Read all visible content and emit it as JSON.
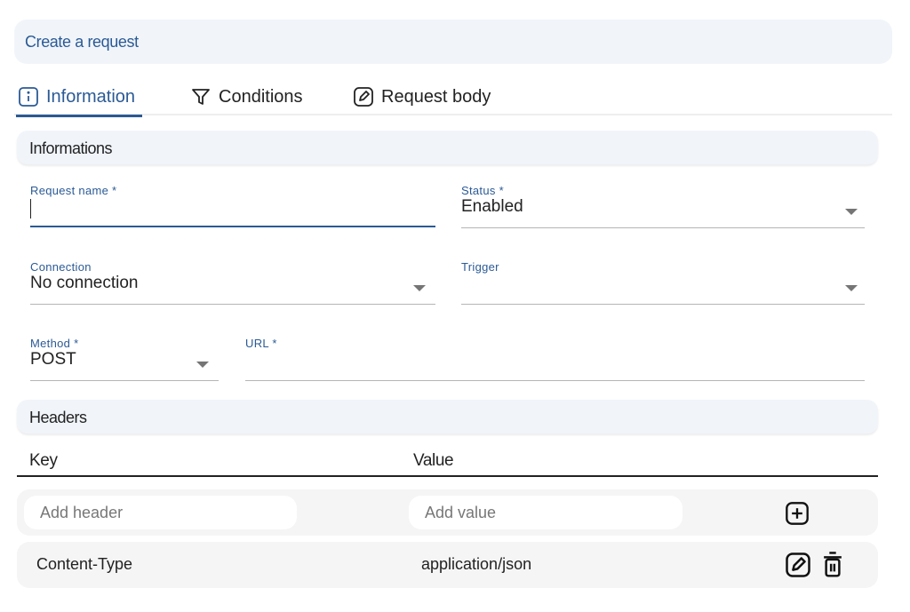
{
  "header": {
    "title": "Create a request"
  },
  "tabs": [
    {
      "label": "Information",
      "icon": "info-icon",
      "active": true
    },
    {
      "label": "Conditions",
      "icon": "filter-icon",
      "active": false
    },
    {
      "label": "Request body",
      "icon": "edit-icon",
      "active": false
    }
  ],
  "informations": {
    "title": "Informations",
    "request_name": {
      "label": "Request name *",
      "value": ""
    },
    "status": {
      "label": "Status *",
      "value": "Enabled"
    },
    "connection": {
      "label": "Connection",
      "value": "No connection"
    },
    "trigger": {
      "label": "Trigger",
      "value": ""
    },
    "method": {
      "label": "Method *",
      "value": "POST"
    },
    "url": {
      "label": "URL *",
      "value": ""
    }
  },
  "headers": {
    "title": "Headers",
    "columns": [
      "Key",
      "Value"
    ],
    "new_row": {
      "key_placeholder": "Add header",
      "value_placeholder": "Add value"
    },
    "rows": [
      {
        "key": "Content-Type",
        "value": "application/json"
      }
    ]
  },
  "colors": {
    "accent": "#2b5a95",
    "panel_bg": "#f1f5fa",
    "row_bg": "#f5f5f5"
  }
}
